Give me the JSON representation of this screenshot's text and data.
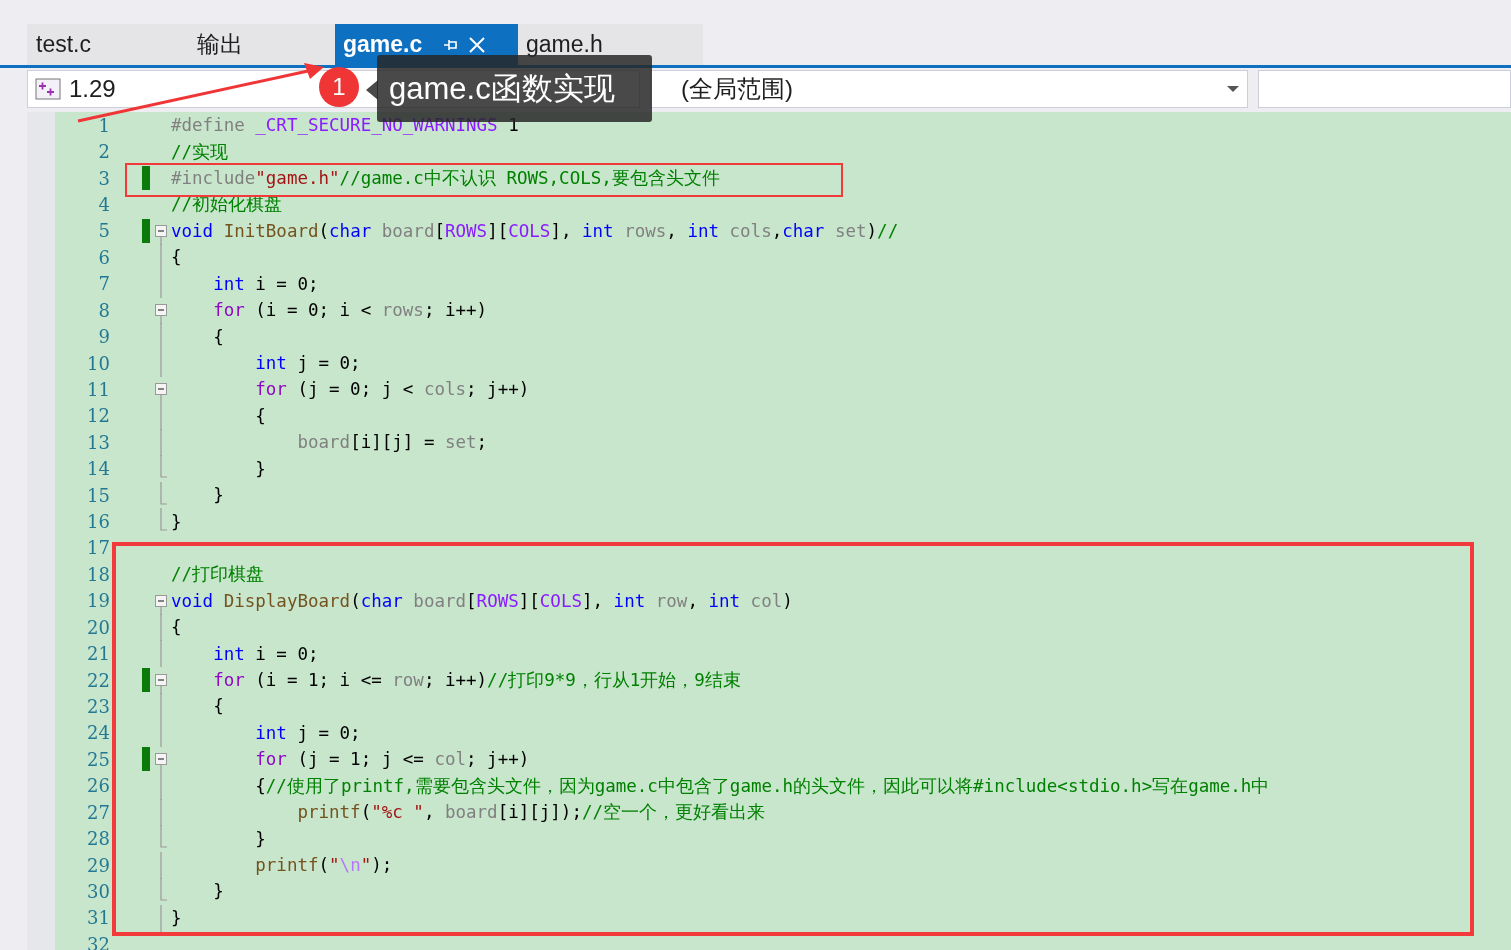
{
  "tabs": [
    {
      "label": "test.c",
      "selected": false
    },
    {
      "label": "输出",
      "selected": false
    },
    {
      "label": "game.c",
      "selected": true
    },
    {
      "label": "game.h",
      "selected": false
    }
  ],
  "navigation": {
    "project": "1.29",
    "scope": "(全局范围)"
  },
  "annotation": {
    "badge": "1",
    "callout": "game.c函数实现"
  },
  "editor": {
    "lines": [
      {
        "n": "1",
        "changed": false,
        "tokens": [
          {
            "kind": "pre",
            "t": "#define"
          },
          {
            "kind": "macro",
            "t": " _CRT_SECURE_NO_WARNINGS"
          },
          {
            "kind": "plain",
            "t": " 1"
          }
        ]
      },
      {
        "n": "2",
        "changed": false,
        "tokens": [
          {
            "kind": "cmt",
            "t": "//实现"
          }
        ]
      },
      {
        "n": "3",
        "changed": true,
        "tokens": [
          {
            "kind": "pre",
            "t": "#include"
          },
          {
            "kind": "str",
            "t": "\"game.h\""
          },
          {
            "kind": "cmt",
            "t": "//game.c中不认识 ROWS,COLS,要包含头文件"
          }
        ]
      },
      {
        "n": "4",
        "changed": false,
        "tokens": [
          {
            "kind": "cmt",
            "t": "//初始化棋盘"
          }
        ]
      },
      {
        "n": "5",
        "changed": true,
        "kind": "fold-open",
        "tokens": [
          {
            "kind": "kw",
            "t": "void"
          },
          {
            "kind": "fn",
            "t": " InitBoard"
          },
          {
            "kind": "plain",
            "t": "("
          },
          {
            "kind": "kw",
            "t": "char"
          },
          {
            "kind": "param",
            "t": " board"
          },
          {
            "kind": "plain",
            "t": "["
          },
          {
            "kind": "macro",
            "t": "ROWS"
          },
          {
            "kind": "plain",
            "t": "]["
          },
          {
            "kind": "macro",
            "t": "COLS"
          },
          {
            "kind": "plain",
            "t": "],"
          },
          {
            "kind": "kw",
            "t": " int"
          },
          {
            "kind": "param",
            "t": " rows"
          },
          {
            "kind": "plain",
            "t": ","
          },
          {
            "kind": "kw",
            "t": " int"
          },
          {
            "kind": "param",
            "t": " cols"
          },
          {
            "kind": "plain",
            "t": ","
          },
          {
            "kind": "kw",
            "t": "char"
          },
          {
            "kind": "param",
            "t": " set"
          },
          {
            "kind": "plain",
            "t": ")"
          },
          {
            "kind": "cmt",
            "t": "//"
          }
        ]
      },
      {
        "n": "6",
        "changed": false,
        "kind": "fold-bar",
        "tokens": [
          {
            "kind": "plain",
            "t": "{"
          }
        ]
      },
      {
        "n": "7",
        "changed": false,
        "kind": "fold-bar",
        "tokens": [
          {
            "kind": "kw",
            "t": "    int"
          },
          {
            "kind": "plain",
            "t": " i = 0;"
          }
        ]
      },
      {
        "n": "8",
        "changed": false,
        "kind": "fold-open",
        "tokens": [
          {
            "kind": "ctl",
            "t": "    for"
          },
          {
            "kind": "plain",
            "t": " (i = 0; i < "
          },
          {
            "kind": "param",
            "t": "rows"
          },
          {
            "kind": "plain",
            "t": "; i++)"
          }
        ]
      },
      {
        "n": "9",
        "changed": false,
        "kind": "fold-bar",
        "tokens": [
          {
            "kind": "plain",
            "t": "    {"
          }
        ]
      },
      {
        "n": "10",
        "changed": false,
        "kind": "fold-bar",
        "tokens": [
          {
            "kind": "kw",
            "t": "        int"
          },
          {
            "kind": "plain",
            "t": " j = 0;"
          }
        ]
      },
      {
        "n": "11",
        "changed": false,
        "kind": "fold-open",
        "tokens": [
          {
            "kind": "ctl",
            "t": "        for"
          },
          {
            "kind": "plain",
            "t": " (j = 0; j < "
          },
          {
            "kind": "param",
            "t": "cols"
          },
          {
            "kind": "plain",
            "t": "; j++)"
          }
        ]
      },
      {
        "n": "12",
        "changed": false,
        "kind": "fold-bar",
        "tokens": [
          {
            "kind": "plain",
            "t": "        {"
          }
        ]
      },
      {
        "n": "13",
        "changed": false,
        "kind": "fold-bar",
        "tokens": [
          {
            "kind": "param",
            "t": "            board"
          },
          {
            "kind": "plain",
            "t": "[i][j] = "
          },
          {
            "kind": "param",
            "t": "set"
          },
          {
            "kind": "plain",
            "t": ";"
          }
        ]
      },
      {
        "n": "14",
        "changed": false,
        "kind": "fold-end",
        "tokens": [
          {
            "kind": "plain",
            "t": "        }"
          }
        ]
      },
      {
        "n": "15",
        "changed": false,
        "kind": "fold-end",
        "tokens": [
          {
            "kind": "plain",
            "t": "    }"
          }
        ]
      },
      {
        "n": "16",
        "changed": false,
        "kind": "fold-end",
        "tokens": [
          {
            "kind": "plain",
            "t": "}"
          }
        ]
      },
      {
        "n": "17",
        "changed": false
      },
      {
        "n": "18",
        "changed": false,
        "tokens": [
          {
            "kind": "cmt",
            "t": "//打印棋盘"
          }
        ]
      },
      {
        "n": "19",
        "changed": false,
        "kind": "fold-open",
        "tokens": [
          {
            "kind": "kw",
            "t": "void"
          },
          {
            "kind": "fn",
            "t": " DisplayBoard"
          },
          {
            "kind": "plain",
            "t": "("
          },
          {
            "kind": "kw",
            "t": "char"
          },
          {
            "kind": "param",
            "t": " board"
          },
          {
            "kind": "plain",
            "t": "["
          },
          {
            "kind": "macro",
            "t": "ROWS"
          },
          {
            "kind": "plain",
            "t": "]["
          },
          {
            "kind": "macro",
            "t": "COLS"
          },
          {
            "kind": "plain",
            "t": "],"
          },
          {
            "kind": "kw",
            "t": " int"
          },
          {
            "kind": "param",
            "t": " row"
          },
          {
            "kind": "plain",
            "t": ","
          },
          {
            "kind": "kw",
            "t": " int"
          },
          {
            "kind": "param",
            "t": " col"
          },
          {
            "kind": "plain",
            "t": ")"
          }
        ]
      },
      {
        "n": "20",
        "changed": false,
        "kind": "fold-bar",
        "tokens": [
          {
            "kind": "plain",
            "t": "{"
          }
        ]
      },
      {
        "n": "21",
        "changed": false,
        "kind": "fold-bar",
        "tokens": [
          {
            "kind": "kw",
            "t": "    int"
          },
          {
            "kind": "plain",
            "t": " i = 0;"
          }
        ]
      },
      {
        "n": "22",
        "changed": true,
        "kind": "fold-open",
        "tokens": [
          {
            "kind": "ctl",
            "t": "    for"
          },
          {
            "kind": "plain",
            "t": " (i = 1; i <= "
          },
          {
            "kind": "param",
            "t": "row"
          },
          {
            "kind": "plain",
            "t": "; i++)"
          },
          {
            "kind": "cmt",
            "t": "//打印9*9，行从1开始，9结束"
          }
        ]
      },
      {
        "n": "23",
        "changed": false,
        "kind": "fold-bar",
        "tokens": [
          {
            "kind": "plain",
            "t": "    {"
          }
        ]
      },
      {
        "n": "24",
        "changed": false,
        "kind": "fold-bar",
        "tokens": [
          {
            "kind": "kw",
            "t": "        int"
          },
          {
            "kind": "plain",
            "t": " j = 0;"
          }
        ]
      },
      {
        "n": "25",
        "changed": true,
        "kind": "fold-open",
        "tokens": [
          {
            "kind": "ctl",
            "t": "        for"
          },
          {
            "kind": "plain",
            "t": " (j = 1; j <= "
          },
          {
            "kind": "param",
            "t": "col"
          },
          {
            "kind": "plain",
            "t": "; j++)"
          }
        ]
      },
      {
        "n": "26",
        "changed": false,
        "kind": "fold-bar",
        "tokens": [
          {
            "kind": "plain",
            "t": "        {"
          },
          {
            "kind": "cmt",
            "t": "//使用了printf,需要包含头文件，因为game.c中包含了game.h的头文件，因此可以将#include<stdio.h>写在game.h中"
          }
        ]
      },
      {
        "n": "27",
        "changed": false,
        "kind": "fold-bar",
        "tokens": [
          {
            "kind": "fn",
            "t": "            printf"
          },
          {
            "kind": "plain",
            "t": "("
          },
          {
            "kind": "str",
            "t": "\"%c \""
          },
          {
            "kind": "plain",
            "t": ","
          },
          {
            "kind": "param",
            "t": " board"
          },
          {
            "kind": "plain",
            "t": "[i][j]);"
          },
          {
            "kind": "cmt",
            "t": "//空一个，更好看出来"
          }
        ]
      },
      {
        "n": "28",
        "changed": false,
        "kind": "fold-end",
        "tokens": [
          {
            "kind": "plain",
            "t": "        }"
          }
        ]
      },
      {
        "n": "29",
        "changed": false,
        "kind": "fold-bar",
        "tokens": [
          {
            "kind": "fn",
            "t": "        printf"
          },
          {
            "kind": "plain",
            "t": "("
          },
          {
            "kind": "str",
            "t": "\""
          },
          {
            "kind": "esc",
            "t": "\\n"
          },
          {
            "kind": "str",
            "t": "\""
          },
          {
            "kind": "plain",
            "t": ");"
          }
        ]
      },
      {
        "n": "30",
        "changed": false,
        "kind": "fold-end",
        "tokens": [
          {
            "kind": "plain",
            "t": "    }"
          }
        ]
      },
      {
        "n": "31",
        "changed": false,
        "kind": "fold-bar",
        "tokens": [
          {
            "kind": "plain",
            "t": "}"
          }
        ]
      },
      {
        "n": "32",
        "changed": false
      }
    ]
  }
}
